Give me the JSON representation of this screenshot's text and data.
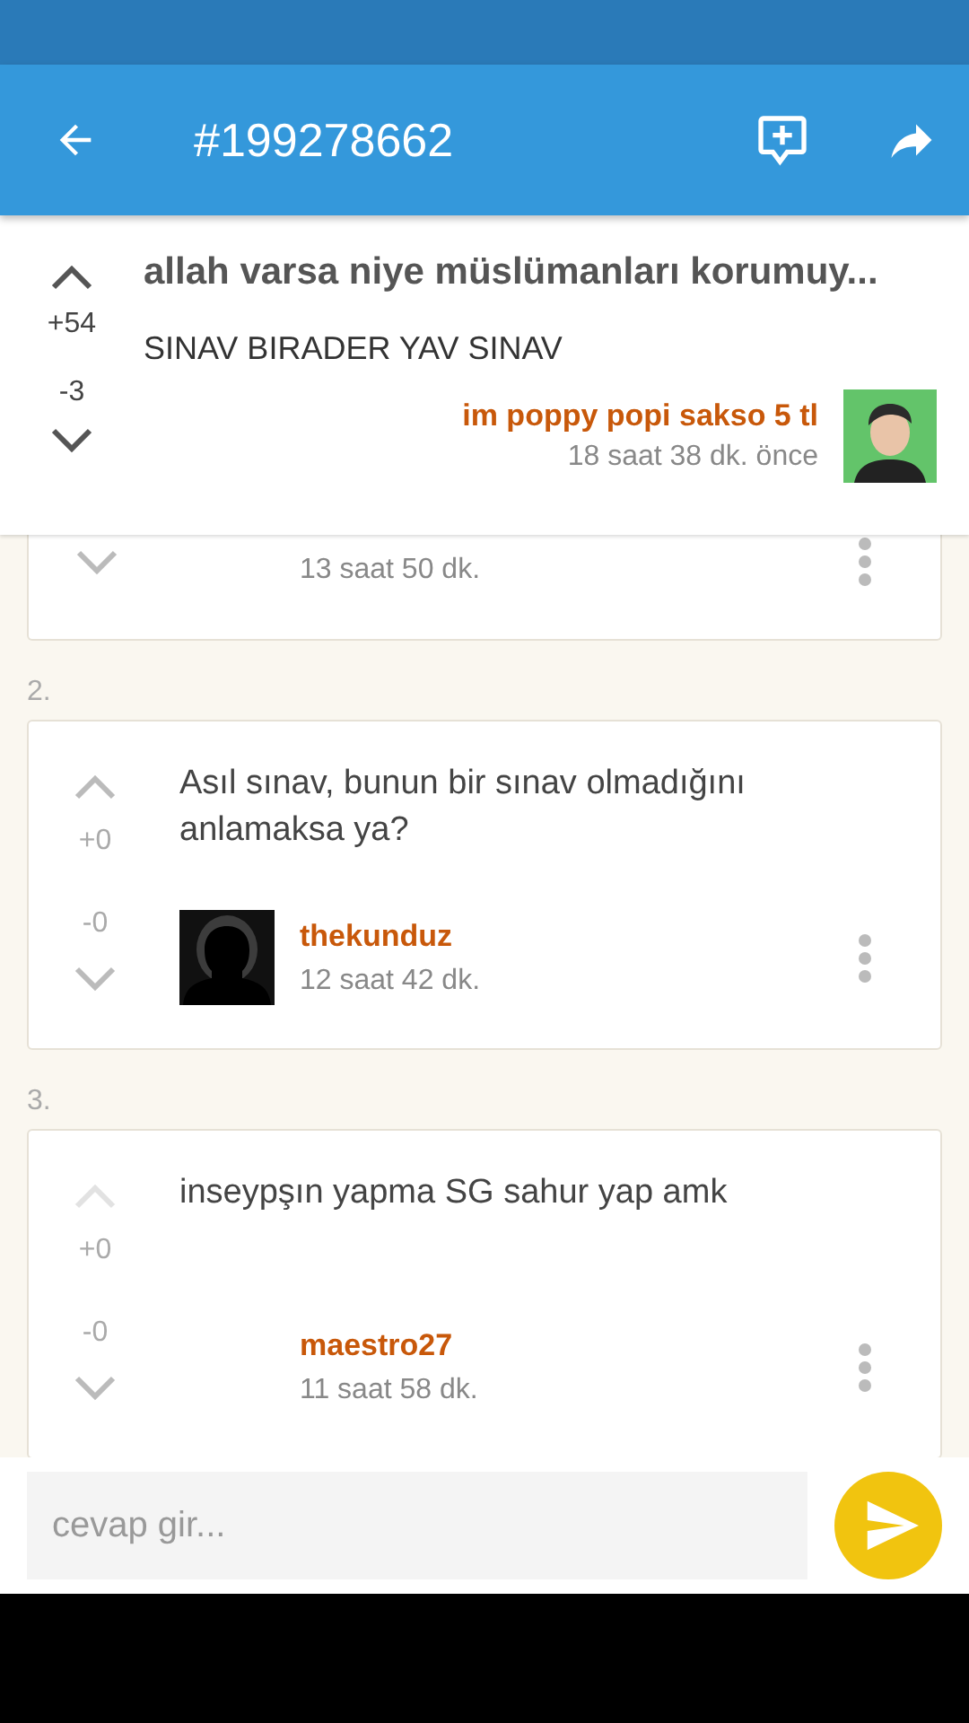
{
  "app_bar": {
    "title": "#199278662"
  },
  "entry": {
    "title": "allah varsa niye müslümanları korumuy...",
    "body": "SINAV BIRADER YAV SINAV",
    "upvotes": "+54",
    "downvotes": "-3",
    "author": "im poppy popi sakso 5 tl",
    "time": "18 saat 38 dk. önce"
  },
  "partial_comment": {
    "time": "13 saat 50 dk."
  },
  "comments": [
    {
      "number": "2.",
      "text": "Asıl sınav, bunun bir sınav olmadığını anlamaksa ya?",
      "upvotes": "+0",
      "downvotes": "-0",
      "author": "thekunduz",
      "time": "12 saat 42 dk.",
      "has_avatar": true,
      "upvote_disabled": false
    },
    {
      "number": "3.",
      "text": "inseypşın yapma SG sahur yap amk",
      "upvotes": "+0",
      "downvotes": "-0",
      "author": "maestro27",
      "time": "11 saat 58 dk.",
      "has_avatar": false,
      "upvote_disabled": true
    }
  ],
  "reply": {
    "placeholder": "cevap gir..."
  }
}
